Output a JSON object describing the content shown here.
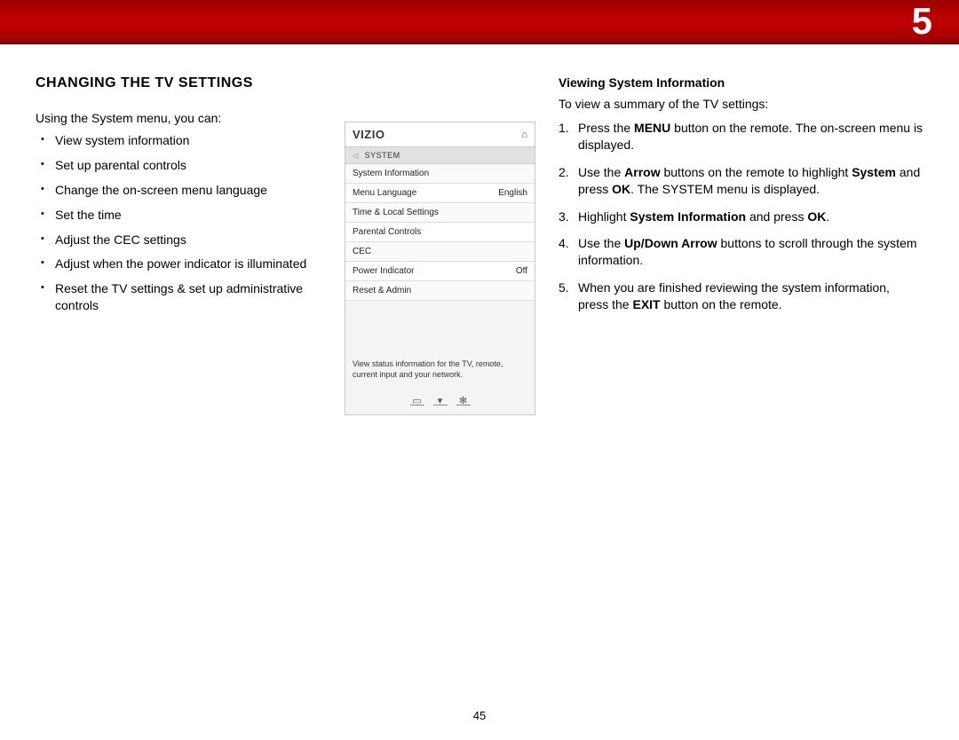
{
  "header": {
    "chapter": "5"
  },
  "left": {
    "title": "CHANGING THE TV SETTINGS",
    "intro": "Using the System menu, you can:",
    "bullets": [
      "View system information",
      "Set up parental controls",
      "Change the on-screen menu language",
      "Set the time",
      "Adjust the CEC settings",
      "Adjust when the power indicator is illuminated",
      "Reset the TV settings & set up administrative controls"
    ]
  },
  "menu": {
    "brand": "VIZIO",
    "crumb": "SYSTEM",
    "rows": [
      {
        "label": "System Information",
        "value": ""
      },
      {
        "label": "Menu Language",
        "value": "English"
      },
      {
        "label": "Time & Local Settings",
        "value": ""
      },
      {
        "label": "Parental Controls",
        "value": ""
      },
      {
        "label": "CEC",
        "value": ""
      },
      {
        "label": "Power Indicator",
        "value": "Off"
      },
      {
        "label": "Reset & Admin",
        "value": ""
      }
    ],
    "help": "View status information for the TV, remote, current input and your network."
  },
  "right": {
    "heading": "Viewing System Information",
    "intro": "To view a summary of the TV settings:",
    "steps": [
      "Press the <b>MENU</b> button on the remote. The on-screen menu is displayed.",
      "Use the <b>Arrow</b> buttons on the remote to highlight <b>System</b> and press <b>OK</b>. The SYSTEM menu is displayed.",
      "Highlight <b>System Information</b> and press <b>OK</b>.",
      "Use the <b>Up/Down Arrow</b> buttons to scroll through the system information.",
      "When you are finished reviewing the system information, press the <b>EXIT</b> button on the remote."
    ]
  },
  "pageNumber": "45"
}
